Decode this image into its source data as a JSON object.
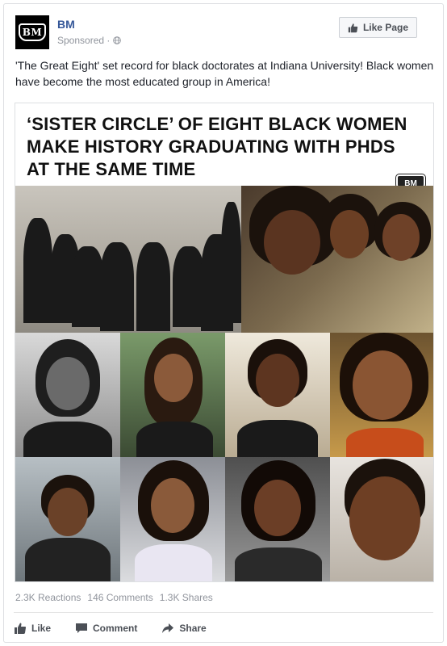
{
  "post": {
    "page_name": "BM",
    "avatar_text": "BM",
    "sponsored": "Sponsored ·",
    "text": "'The Great Eight' set record for black doctorates at Indiana University! Black women have become the most educated group in America!"
  },
  "header": {
    "like_page_label": "Like Page"
  },
  "image": {
    "headline": "‘SISTER CIRCLE’ OF EIGHT BLACK WOMEN MAKE HISTORY GRADUATING WITH PHDS AT THE SAME TIME",
    "watermark": "BM"
  },
  "stats": {
    "reactions": "2.3K Reactions",
    "comments": "146 Comments",
    "shares": "1.3K Shares"
  },
  "actions": {
    "like": "Like",
    "comment": "Comment",
    "share": "Share"
  },
  "icons": {
    "avatar": "bm-logo-icon",
    "globe": "globe-icon",
    "like_page": "thumbs-up-icon",
    "like": "thumbs-up-icon",
    "comment": "comment-icon",
    "share": "share-arrow-icon"
  },
  "colors": {
    "link": "#365899",
    "muted": "#90949c",
    "text": "#1d2129"
  }
}
